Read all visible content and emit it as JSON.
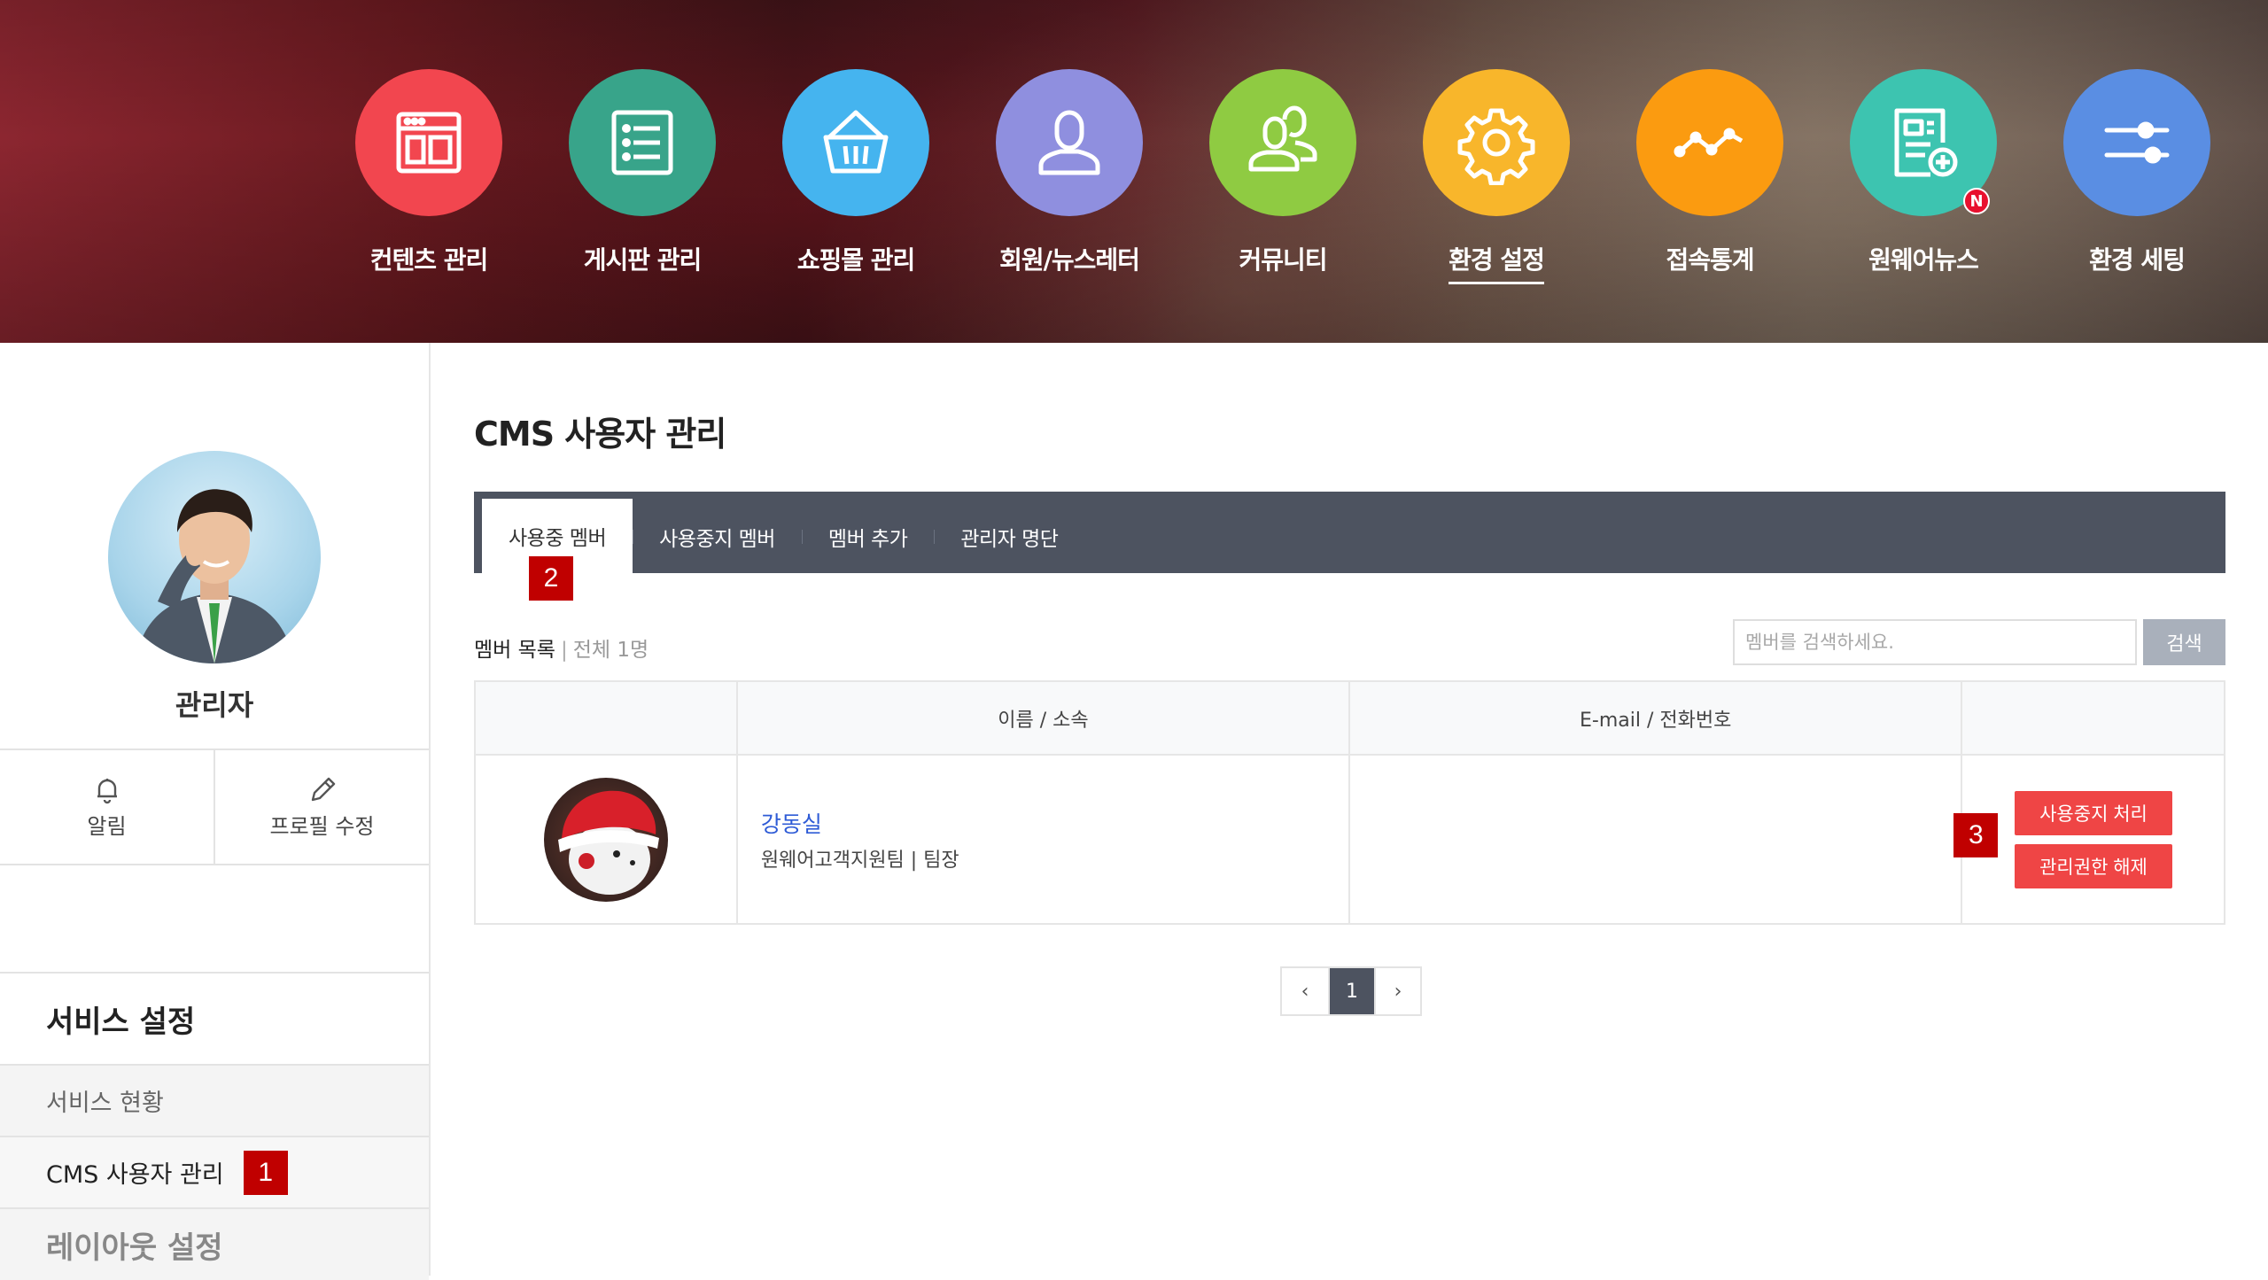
{
  "topnav": {
    "items": [
      {
        "label": "컨텐츠 관리",
        "icon": "content-layout-icon",
        "color": "#f2464f"
      },
      {
        "label": "게시판 관리",
        "icon": "list-icon",
        "color": "#38a48a"
      },
      {
        "label": "쇼핑몰 관리",
        "icon": "basket-icon",
        "color": "#45b4ef"
      },
      {
        "label": "회원/뉴스레터",
        "icon": "user-icon",
        "color": "#8f8fdf"
      },
      {
        "label": "커뮤니티",
        "icon": "users-icon",
        "color": "#8fcb42"
      },
      {
        "label": "환경 설정",
        "icon": "gear-icon",
        "color": "#f8b62b"
      },
      {
        "label": "접속통계",
        "icon": "trend-icon",
        "color": "#fb9b10"
      },
      {
        "label": "원웨어뉴스",
        "icon": "news-add-icon",
        "color": "#3dc4b0",
        "badge": "N"
      },
      {
        "label": "환경 세팅",
        "icon": "sliders-icon",
        "color": "#5a8ee3"
      }
    ],
    "active_label": "환경 설정"
  },
  "sidebar": {
    "profile_name": "관리자",
    "actions": [
      {
        "label": "알림",
        "icon": "bell-icon"
      },
      {
        "label": "프로필 수정",
        "icon": "pencil-icon"
      }
    ],
    "section_title": "서비스 설정",
    "items": [
      {
        "label": "서비스 현황"
      },
      {
        "label": "CMS 사용자 관리"
      }
    ],
    "section_title_2": "레이아웃 설정"
  },
  "markers": {
    "m1": "1",
    "m2": "2",
    "m3": "3"
  },
  "main": {
    "title": "CMS 사용자 관리",
    "tabs": [
      {
        "label": "사용중 멤버"
      },
      {
        "label": "사용중지 멤버"
      },
      {
        "label": "멤버 추가"
      },
      {
        "label": "관리자 명단"
      }
    ],
    "list_label": "멤버 목록",
    "list_count": "전체 1명",
    "search_placeholder": "멤버를 검색하세요.",
    "search_button": "검색",
    "table": {
      "headers": [
        "",
        "이름 / 소속",
        "E-mail / 전화번호",
        ""
      ],
      "rows": [
        {
          "name": "강동실",
          "org": "원웨어고객지원팀 | 팀장",
          "email_phone": "",
          "actions": [
            "사용중지 처리",
            "관리권한 해제"
          ]
        }
      ]
    },
    "pager": {
      "prev": "‹",
      "page": "1",
      "next": "›"
    }
  }
}
